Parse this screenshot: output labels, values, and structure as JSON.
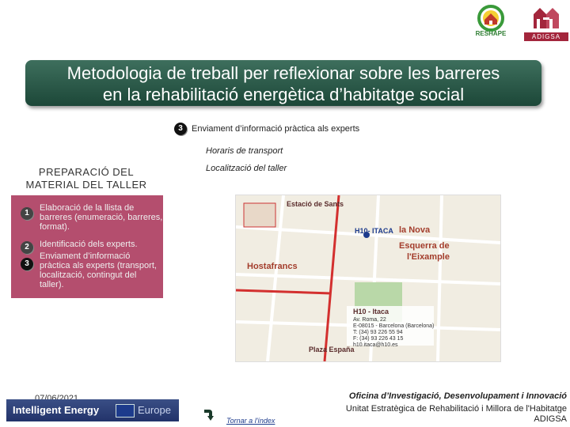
{
  "logos": {
    "reshape": "RESHAPE",
    "adigsa": "ADIGSA"
  },
  "title": {
    "line1": "Metodologia de treball per reflexionar sobre les barreres",
    "line2": "en la rehabilitació energètica d’habitatge social"
  },
  "step3": {
    "number": "3",
    "title": "Enviament d’informació pràctica als experts",
    "items": [
      "Horaris de transport",
      "Localització del taller"
    ]
  },
  "preparation": {
    "title_line1": "PREPARACIÓ DEL",
    "title_line2": "MATERIAL DEL TALLER",
    "items": [
      {
        "number": "1",
        "text": "Elaboració de la llista de barreres (enumeració, barreres, format)."
      },
      {
        "number": "2",
        "text": "Identificació dels experts."
      },
      {
        "number": "3",
        "text": "Enviament d’informació pràctica als experts (transport, localització, contingut del taller)."
      }
    ]
  },
  "map": {
    "station": "Estació de Sants",
    "hotel_tag": "H10- ITACA",
    "district1": "la Nova",
    "district2": "Esquerra de",
    "district3": "l'Eixample",
    "district4": "Hostafrancs",
    "plaza": "Plaza España",
    "hotel_name": "H10 - Itaca",
    "address": [
      "Av. Roma, 22",
      "E-08015 - Barcelona (Barcelona)",
      "T: (34) 93 226 55 94",
      "F: (34) 93 226 43 15",
      "h10.itaca@h10.es"
    ]
  },
  "footer": {
    "date": "07/06/2021",
    "ie_brand": "Intelligent Energy",
    "ie_europe": "Europe",
    "back_link": "Tornar a l'índex",
    "office": "Oficina d’Investigació, Desenvolupament i Innovació",
    "unit_line1": "Unitat Estratègica de Rehabilitació i Millora de l'Habitatge",
    "unit_line2": "ADIGSA"
  },
  "colors": {
    "banner": "#2c5a49",
    "panel": "#b44e6e",
    "accent_red": "#a3263c"
  }
}
